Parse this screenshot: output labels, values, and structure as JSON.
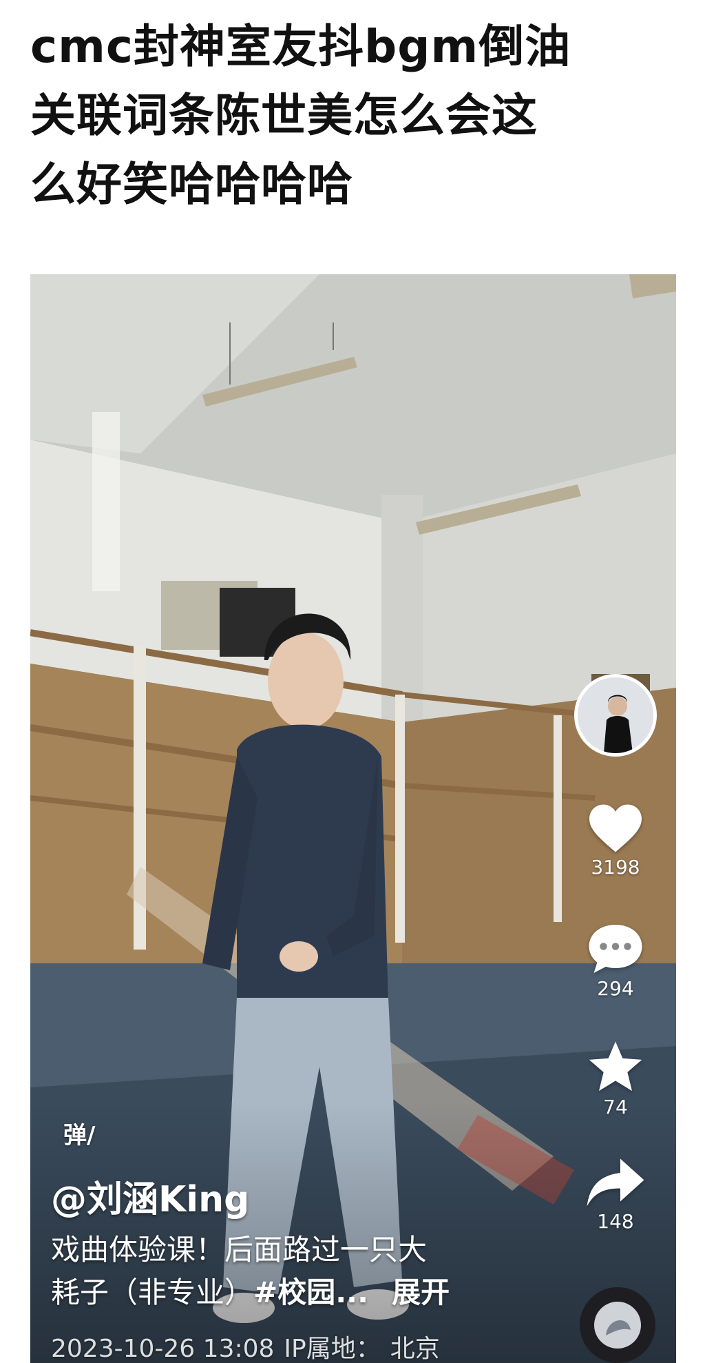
{
  "headline": {
    "line1": "cmc封神室友抖bgm倒油",
    "line2": "关联词条陈世美怎么会这",
    "line3": "么好笑哈哈哈哈"
  },
  "video": {
    "danmu_label": "弹",
    "author": "@刘涵King",
    "caption_line1": "戏曲体验课！后面路过一只大",
    "caption_line2_text": "耗子（非专业）",
    "caption_tag": "#校园...",
    "expand_label": "展开",
    "date": "2023-10-26 13:08",
    "ip_label": "IP属地：",
    "ip_location": "北京",
    "likes": "3198",
    "comments": "294",
    "favorites": "74",
    "shares": "148"
  },
  "icons": [
    "avatar",
    "heart-icon",
    "comment-icon",
    "star-icon",
    "share-icon",
    "music-disc-icon"
  ],
  "colors": {
    "background": "#ffffff",
    "headline": "#111111",
    "overlay_text": "#ffffff"
  }
}
